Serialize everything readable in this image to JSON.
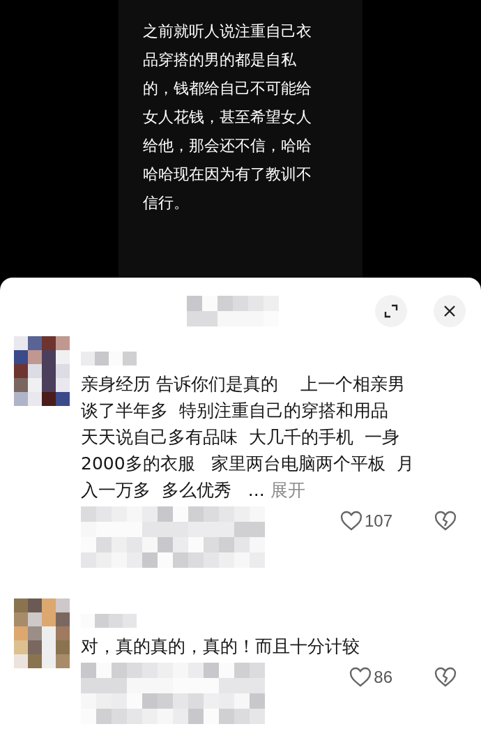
{
  "video": {
    "caption": "之前就听人说注重自己衣品穿搭的男的都是自私的，钱都给自己不可能给女人花钱，甚至希望女人给他，那会还不信，哈哈哈哈现在因为有了教训不信行。"
  },
  "comments": [
    {
      "lines": [
        "亲身经历 告诉你们是真的    上一个相亲男",
        "谈了半年多  特别注重自己的穿搭和用品",
        "天天说自己多有品味  大几千的手机  一身",
        "2000多的衣服   家里两台电脑两个平板  月",
        "入一万多  多么优秀   ..."
      ],
      "expand_label": "展开",
      "likes": "107",
      "liked": false
    },
    {
      "lines": [
        "对，真的真的，真的！而且十分计较"
      ],
      "likes": "86",
      "liked": false
    }
  ]
}
